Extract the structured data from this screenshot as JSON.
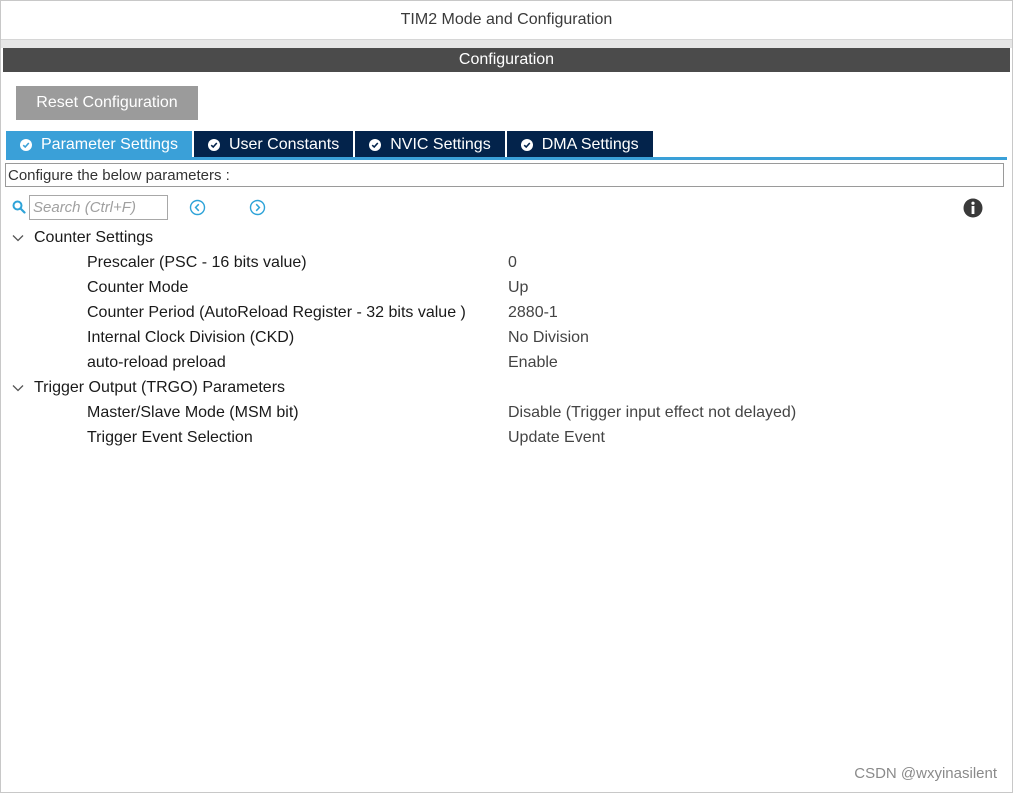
{
  "window": {
    "title": "TIM2 Mode and Configuration"
  },
  "section": {
    "title": "Configuration"
  },
  "toolbar": {
    "reset_label": "Reset Configuration"
  },
  "tabs": [
    {
      "label": "Parameter Settings",
      "active": true
    },
    {
      "label": "User Constants",
      "active": false
    },
    {
      "label": "NVIC Settings",
      "active": false
    },
    {
      "label": "DMA Settings",
      "active": false
    }
  ],
  "description": "Configure the below parameters :",
  "search": {
    "placeholder": "Search (Ctrl+F)",
    "value": ""
  },
  "groups": [
    {
      "label": "Counter Settings",
      "expanded": true,
      "params": [
        {
          "name": "Prescaler (PSC - 16 bits value)",
          "value": "0"
        },
        {
          "name": "Counter Mode",
          "value": "Up"
        },
        {
          "name": "Counter Period (AutoReload Register - 32 bits value )",
          "value": "2880-1"
        },
        {
          "name": "Internal Clock Division (CKD)",
          "value": "No Division"
        },
        {
          "name": "auto-reload preload",
          "value": "Enable"
        }
      ]
    },
    {
      "label": "Trigger Output (TRGO) Parameters",
      "expanded": true,
      "params": [
        {
          "name": "Master/Slave Mode (MSM bit)",
          "value": "Disable (Trigger input effect not delayed)"
        },
        {
          "name": "Trigger Event Selection",
          "value": "Update Event"
        }
      ]
    }
  ],
  "watermark": "CSDN @wxyinasilent",
  "colors": {
    "tab_active": "#3aa0d8",
    "tab_inactive": "#03234b",
    "config_bar": "#4b4b4b",
    "reset_button": "#9b9b9b",
    "nav_icon": "#2ea3d8",
    "search_icon": "#2ea3d8"
  },
  "icons": {
    "tab_status": "check-circle-icon",
    "search": "search-icon",
    "previous": "circle-chevron-left-icon",
    "next": "circle-chevron-right-icon",
    "info": "info-icon",
    "group_toggle": "chevron-down-icon"
  }
}
